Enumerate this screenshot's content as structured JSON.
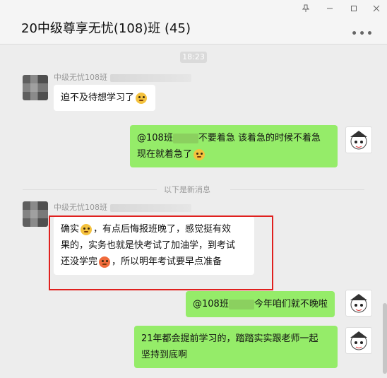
{
  "window": {
    "title": "20中级尊享无忧(108)班 (45)",
    "buttons": [
      "pin-icon",
      "minimize-icon",
      "maximize-icon",
      "close-icon"
    ]
  },
  "chat": {
    "timestamp": "18:23",
    "separator": "以下是新消息",
    "messages": [
      {
        "side": "left",
        "sender": "中级无忧108班",
        "text": "迫不及待想学习了"
      },
      {
        "side": "right",
        "line1_prefix": "@108班",
        "line1_suffix": "不要着急  该着急的时候不着急",
        "line2": "现在就着急了"
      },
      {
        "side": "left",
        "sender": "中级无忧108班",
        "line1_a": "确实",
        "line1_b": "，有点后悔报班晚了，感觉挺有效",
        "line2": "果的，实务也就是快考试了加油学，到考试",
        "line3_a": "还没学完",
        "line3_b": "，所以明年考试要早点准备"
      },
      {
        "side": "right",
        "prefix": "@108班",
        "suffix": "今年咱们就不晚啦"
      },
      {
        "side": "right",
        "line1": "21年都会提前学习的，踏踏实实跟老师一起",
        "line2": "坚持到底啊"
      }
    ]
  },
  "colors": {
    "green_bubble": "#95ec69",
    "highlight": "#e0201e"
  }
}
